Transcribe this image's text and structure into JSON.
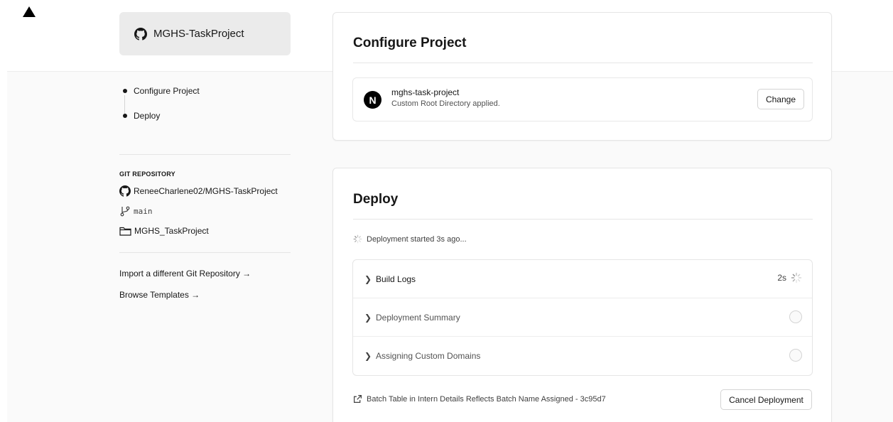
{
  "sidebar": {
    "repo_chip_label": "MGHS-TaskProject",
    "steps": [
      "Configure Project",
      "Deploy"
    ],
    "git": {
      "heading": "GIT REPOSITORY",
      "repo": "ReneeCharlene02/MGHS-TaskProject",
      "branch": "main",
      "directory": "MGHS_TaskProject"
    },
    "links": {
      "import": "Import a different Git Repository →",
      "templates": "Browse Templates →"
    }
  },
  "configure": {
    "title": "Configure Project",
    "project_name": "mghs-task-project",
    "project_note": "Custom Root Directory applied.",
    "logo_letter": "N",
    "change_label": "Change"
  },
  "deploy": {
    "title": "Deploy",
    "status": "Deployment started 3s ago...",
    "steps": [
      {
        "label": "Build Logs",
        "time": "2s"
      },
      {
        "label": "Deployment Summary"
      },
      {
        "label": "Assigning Custom Domains"
      }
    ],
    "commit_message": "Batch Table in Intern Details Reflects Batch Name Assigned - 3c95d7",
    "cancel_label": "Cancel Deployment"
  },
  "icons": {
    "logo": "triangle-logo-icon",
    "github": "github-icon",
    "branch": "git-branch-icon",
    "folder": "folder-icon",
    "spinner": "spinner-icon",
    "chevron": "chevron-right-icon",
    "external": "external-link-icon"
  }
}
